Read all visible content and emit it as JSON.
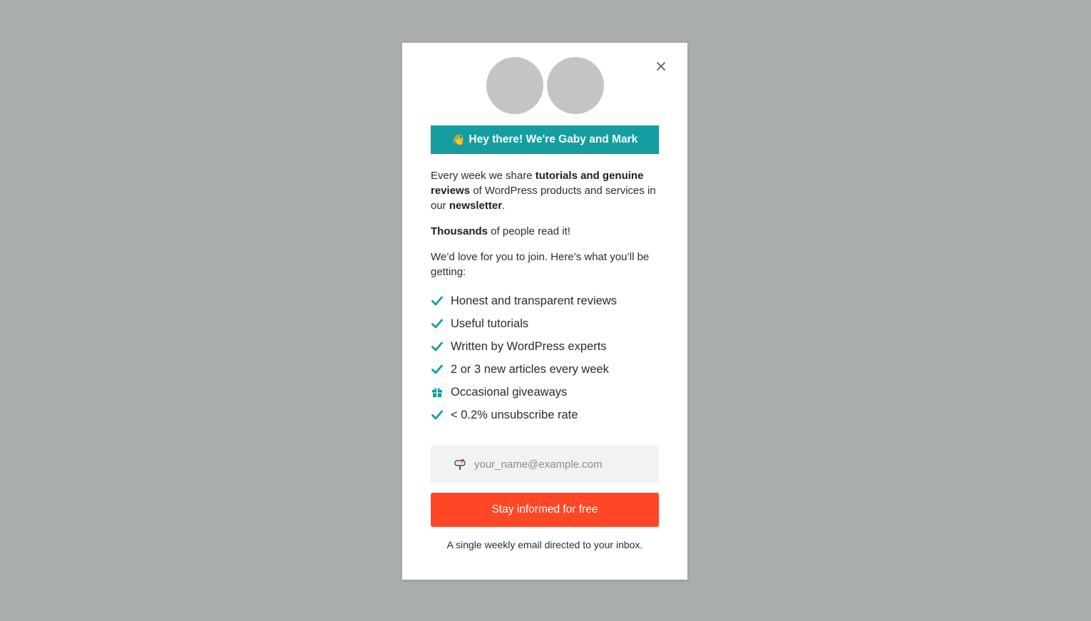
{
  "colors": {
    "page_background": "#a9adac",
    "banner_background": "#159d9f",
    "accent": "#159d9f",
    "cta_background": "#ff4726",
    "input_background": "#f2f2f2",
    "avatar_placeholder": "#c4c4c4"
  },
  "modal": {
    "close_icon": "close-icon",
    "banner": {
      "emoji": "👋",
      "text": "Hey there! We're Gaby and Mark"
    },
    "intro": {
      "p1_a": "Every week we share ",
      "p1_b": "tutorials and genuine reviews",
      "p1_c": " of WordPress products and services in our ",
      "p1_d": "newsletter",
      "p1_e": ".",
      "p2_a": "Thousands",
      "p2_b": " of people read it!",
      "p3": "We’d love for you to join. Here’s what you’ll be getting:"
    },
    "features": [
      {
        "icon": "check-icon",
        "label": "Honest and transparent reviews"
      },
      {
        "icon": "check-icon",
        "label": "Useful tutorials"
      },
      {
        "icon": "check-icon",
        "label": "Written by WordPress experts"
      },
      {
        "icon": "check-icon",
        "label": "2 or 3 new articles every week"
      },
      {
        "icon": "gift-icon",
        "label": "Occasional giveaways"
      },
      {
        "icon": "check-icon",
        "label": "< 0.2% unsubscribe rate"
      }
    ],
    "email": {
      "icon": "mailbox-icon",
      "value": "",
      "placeholder": "your_name@example.com"
    },
    "cta_label": "Stay informed for free",
    "footnote": "A single weekly email directed to your inbox."
  }
}
